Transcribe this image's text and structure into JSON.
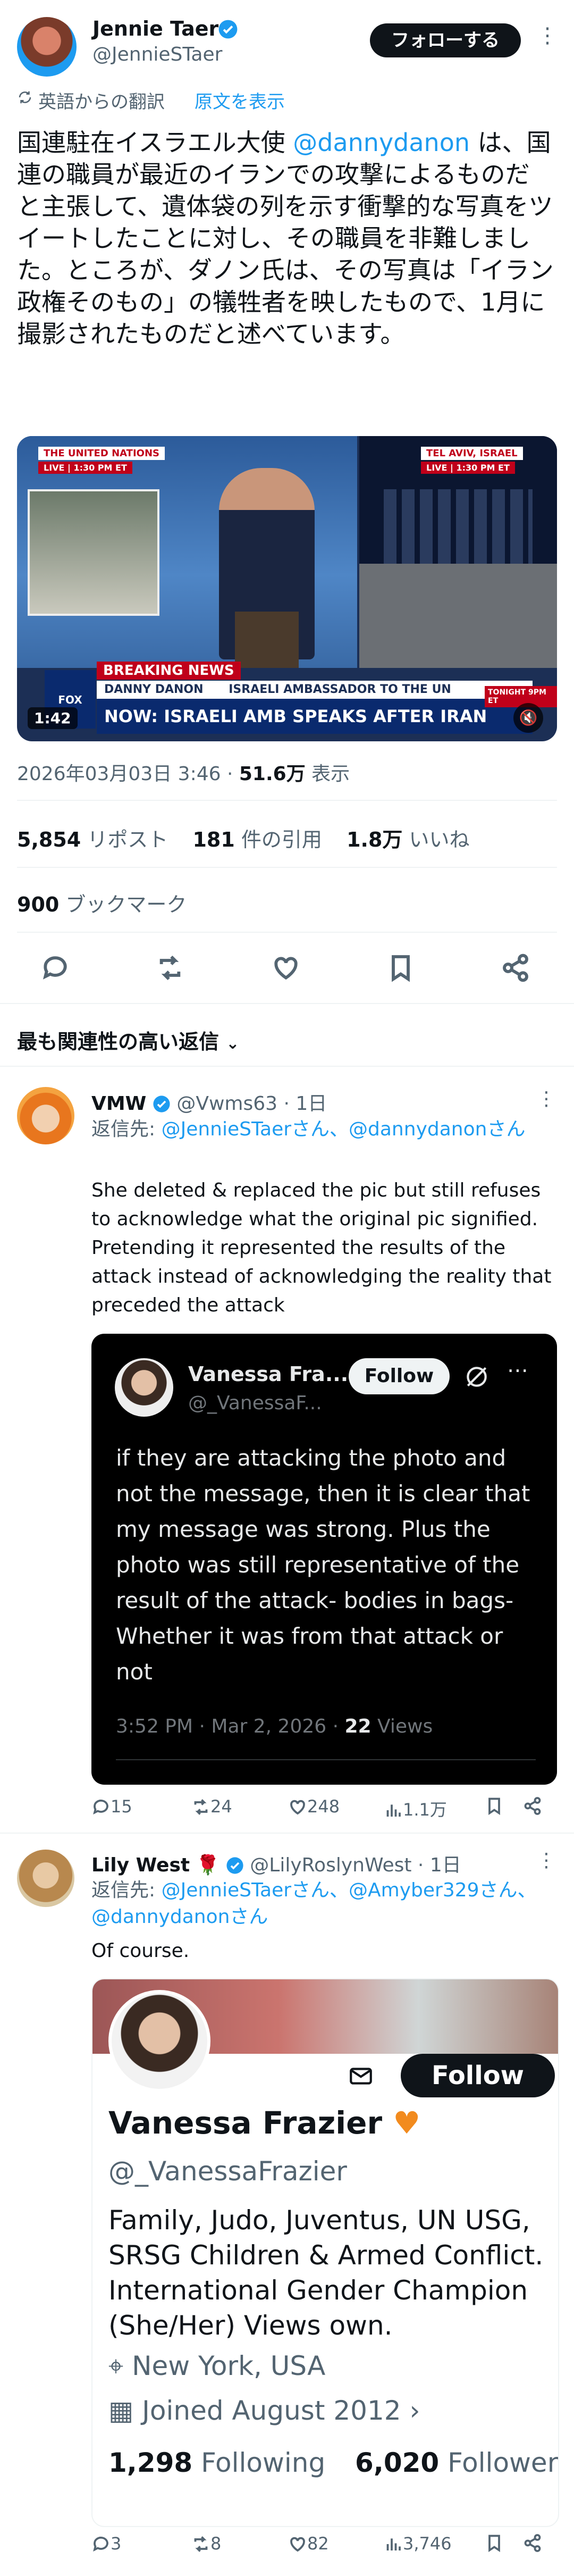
{
  "tweet": {
    "author_name": "Jennie Taer",
    "author_handle": "@JennieSTaer",
    "follow_label": "フォローする",
    "translated_from": "英語からの翻訳",
    "show_original": "原文を表示",
    "text_parts": [
      "国連駐在イスラエル大使 ",
      "@dannydanon",
      " は、国連の職員が最近のイランでの攻撃によるものだと主張して、遺体袋の列を示す衝撃的な写真をツイートしたことに対し、その職員を非難しました。ところが、ダノン氏は、その写真は「イラン政権そのもの」の犠牲者を映したもので、1月に撮影されたものだと述べています。"
    ],
    "video": {
      "tag_left": "THE UNITED NATIONS",
      "time_left": "LIVE | 1:30 PM ET",
      "tag_right": "TEL AVIV, ISRAEL",
      "time_right": "LIVE | 1:30 PM ET",
      "breaking": "BREAKING NEWS",
      "person_label": "DANNY DANON",
      "person_title": "ISRAELI AMBASSADOR TO THE UN",
      "headline": "NOW: ISRAELI AMB SPEAKS AFTER IRAN LEADER KILLED",
      "network": "FOX NEWS",
      "duration": "1:42",
      "promo": "TONIGHT 9PM ET"
    },
    "timestamp": "2026年03月03日 3:46",
    "views_count": "51.6万",
    "views_label": " 表示",
    "reposts": "5,854",
    "reposts_label": " リポスト",
    "quotes": "181",
    "quotes_label": " 件の引用",
    "likes": "1.8万",
    "likes_label": " いいね",
    "bookmarks": "900",
    "bookmarks_label": " ブックマーク"
  },
  "sort_label": "最も関連性の高い返信",
  "replies": [
    {
      "name": "VMW",
      "handle": "@Vwms63",
      "time": "1日",
      "reply_to_prefix": "返信先: ",
      "reply_to": "@JennieSTaerさん、@dannydanonさん",
      "text": "She deleted & replaced the pic but still refuses to acknowledge what the original pic signified. Pretending it represented the results of the attack instead of acknowledging the reality that preceded the attack",
      "quote": {
        "name": "Vanessa Fra...",
        "handle": "@_VanessaF...",
        "follow": "Follow",
        "text": "if they are attacking the photo and not the message, then it is clear that my message was strong. Plus the photo was still representative of the result of the attack- bodies in bags- Whether it was from that attack or not",
        "time": "3:52 PM · Mar 2, 2026 · ",
        "views": "22",
        "views_label": " Views"
      },
      "stats": {
        "replies": "15",
        "reposts": "24",
        "likes": "248",
        "views": "1.1万"
      }
    },
    {
      "name": "Lily West",
      "handle": "@LilyRoslynWest",
      "time": "1日",
      "reply_to_prefix": "返信先: ",
      "reply_to": "@JennieSTaerさん、@Amyber329さん、@dannydanonさん",
      "text": "Of course.",
      "card": {
        "follow": "Follow",
        "name": "Vanessa Frazier",
        "handle": "@_VanessaFrazier",
        "bio": "Family, Judo, Juventus, UN USG, SRSG Children & Armed Conflict. International Gender Champion (She/Her) Views own.",
        "location": "New York, USA",
        "joined": "Joined August 2012",
        "following_count": "1,298",
        "following_label": "Following",
        "followers_count": "6,020",
        "followers_label": "Followers"
      },
      "stats": {
        "replies": "3",
        "reposts": "8",
        "likes": "82",
        "views": "3,746"
      }
    }
  ],
  "colors": {
    "accent": "#1d9bf0",
    "text": "#0f1419",
    "muted": "#536471"
  }
}
